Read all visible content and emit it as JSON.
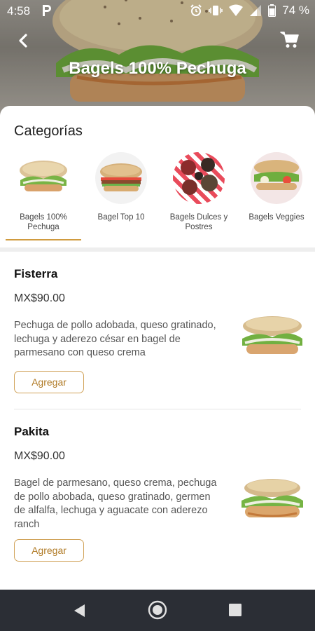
{
  "status_bar": {
    "time": "4:58",
    "battery": "74 %"
  },
  "header": {
    "title": "Bagels 100% Pechuga",
    "back_icon": "back-arrow-icon",
    "cart_icon": "shopping-cart-icon"
  },
  "categories_section": {
    "title": "Categorías",
    "items": [
      {
        "label": "Bagels 100% Pechuga",
        "selected": true
      },
      {
        "label": "Bagel Top 10",
        "selected": false
      },
      {
        "label": "Bagels Dulces y Postres",
        "selected": false
      },
      {
        "label": "Bagels Veggies",
        "selected": false
      }
    ]
  },
  "products": [
    {
      "name": "Fisterra",
      "price": "MX$90.00",
      "description": "Pechuga de pollo adobada, queso gratinado, lechuga y aderezo césar en bagel de parmesano con queso crema",
      "button": "Agregar"
    },
    {
      "name": "Pakita",
      "price": "MX$90.00",
      "description": "Bagel de parmesano, queso crema, pechuga de pollo abobada, queso gratinado, germen de alfalfa, lechuga y aguacate con aderezo ranch",
      "button": "Agregar"
    }
  ],
  "colors": {
    "accent": "#d09b3f",
    "button_border": "#d1a35a",
    "nav_bar": "#2b2e35"
  }
}
